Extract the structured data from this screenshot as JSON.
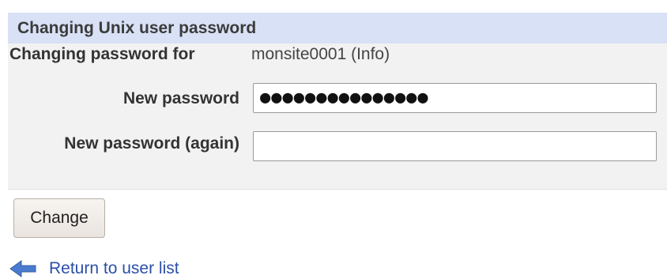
{
  "panel": {
    "title": "Changing Unix user password",
    "changing_label": "Changing password for",
    "username_display": "monsite0001 (Info)",
    "new_password_label": "New password",
    "new_password_again_label": "New password (again)",
    "new_password_value": "●●●●●●●●●●●●●●●",
    "new_password_again_value": ""
  },
  "actions": {
    "change_label": "Change"
  },
  "footer": {
    "return_link_label": "Return to user list",
    "return_icon": "left-arrow-icon"
  },
  "colors": {
    "header_bg": "#d8e1f5",
    "panel_bg": "#f2f2f2",
    "link": "#2b4fa8",
    "arrow_icon": "#4a7bd0"
  }
}
